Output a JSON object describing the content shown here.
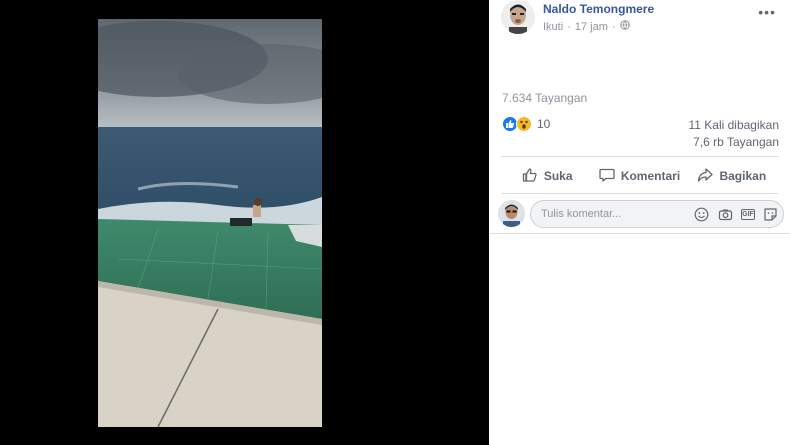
{
  "post": {
    "author": "Naldo Temongmere",
    "follow_label": "Ikuti",
    "time": "17 jam",
    "views": "7.634 Tayangan",
    "reaction_count": "10",
    "shares": "11 Kali dibagikan",
    "views_short": "7,6 rb Tayangan"
  },
  "actions": {
    "like": "Suka",
    "comment": "Komentari",
    "share": "Bagikan"
  },
  "comment_box": {
    "placeholder": "Tulis komentar..."
  },
  "icons": {
    "privacy": "globe-icon",
    "menu": "more-options-icon",
    "like_reaction": "like-reaction-icon",
    "wow_reaction": "wow-reaction-icon",
    "like_action": "thumbs-up-icon",
    "comment_action": "speech-bubble-icon",
    "share_action": "share-arrow-icon",
    "emoji": "smiley-icon",
    "camera": "camera-icon",
    "gif": "gif-icon",
    "sticker": "sticker-icon"
  },
  "colors": {
    "link_blue": "#385898",
    "like_blue": "#1877f2",
    "wow_yellow": "#f7b928",
    "text_gray": "#606770",
    "meta_gray": "#90949c"
  }
}
